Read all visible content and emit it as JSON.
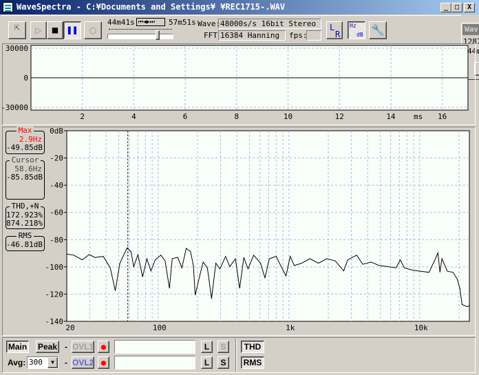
{
  "window": {
    "title": "WaveSpectra - C:¥Documents and Settings¥                    ¥REC1715-.WAV",
    "minimize": "_",
    "maximize": "□",
    "close": "X"
  },
  "toolbar": {
    "elapsed": "44m41s",
    "transport": "⏮◀▶⏭",
    "total": "57m51s",
    "wave_label": "Wave:",
    "wave_value": "48000s/s 16bit Stereo",
    "fft_label": "FFT:",
    "fft_value": "16384 Hanning",
    "fps_label": "fps:",
    "fps_value": "",
    "position_fraction": 0.77,
    "lr_l": "L",
    "lr_r": "R",
    "hz": "Hz",
    "db": "dB"
  },
  "side_window": {
    "title": "Wav",
    "line1": "1287",
    "line2": "44m"
  },
  "waveform": {
    "y_ticks": [
      "30000",
      "0",
      "-30000"
    ],
    "x_ticks": [
      "2",
      "4",
      "6",
      "8",
      "10",
      "12",
      "14",
      "16"
    ],
    "x_unit": "ms",
    "xlim": [
      0,
      17
    ],
    "ylim": [
      -32768,
      32768
    ]
  },
  "readouts": {
    "max": {
      "label": "Max",
      "freq": "2.9Hz",
      "level": "-49.85dB"
    },
    "cursor": {
      "label": "Cursor",
      "freq": "58.6Hz",
      "level": "-85.85dB"
    },
    "thd": {
      "label": "THD,+N",
      "v1": "172.923%",
      "v2": "874.218%"
    },
    "rms": {
      "label": "RMS",
      "level": "-46.81dB"
    }
  },
  "chart_data": {
    "type": "line",
    "xscale": "log",
    "xlim": [
      20,
      24000
    ],
    "ylim": [
      -140,
      0
    ],
    "grid": true,
    "y_ticks": [
      "0dB",
      "-20",
      "-40",
      "-60",
      "-80",
      "-100",
      "-120",
      "-140"
    ],
    "x_ticks": [
      "20",
      "100",
      "1k",
      "10k"
    ],
    "cursor_hz": 58.6,
    "points": [
      [
        20,
        -90.6
      ],
      [
        22.6,
        -91.4
      ],
      [
        26.3,
        -94.8
      ],
      [
        29.7,
        -90.9
      ],
      [
        32.8,
        -93.1
      ],
      [
        38,
        -92.3
      ],
      [
        43,
        -100.7
      ],
      [
        47,
        -117.5
      ],
      [
        51,
        -97.3
      ],
      [
        58,
        -85.9
      ],
      [
        62,
        -88.9
      ],
      [
        65,
        -99.8
      ],
      [
        70,
        -91
      ],
      [
        76,
        -107.4
      ],
      [
        82,
        -94
      ],
      [
        88,
        -103
      ],
      [
        95,
        -94.8
      ],
      [
        105,
        -91.4
      ],
      [
        113,
        -95.6
      ],
      [
        122,
        -115.8
      ],
      [
        128,
        -94
      ],
      [
        141,
        -93
      ],
      [
        152,
        -100.7
      ],
      [
        164,
        -86.4
      ],
      [
        177,
        -88.9
      ],
      [
        186,
        -99
      ],
      [
        192,
        -120.8
      ],
      [
        205,
        -109
      ],
      [
        221,
        -96.5
      ],
      [
        238,
        -100.7
      ],
      [
        256,
        -123.4
      ],
      [
        276,
        -97.3
      ],
      [
        297,
        -101.5
      ],
      [
        328,
        -92.3
      ],
      [
        353,
        -99.8
      ],
      [
        390,
        -94
      ],
      [
        420,
        -115.8
      ],
      [
        452,
        -93
      ],
      [
        487,
        -101.5
      ],
      [
        538,
        -91.4
      ],
      [
        607,
        -97.3
      ],
      [
        656,
        -108.2
      ],
      [
        707,
        -94
      ],
      [
        799,
        -92.3
      ],
      [
        882,
        -100.7
      ],
      [
        951,
        -106.6
      ],
      [
        1023,
        -92.3
      ],
      [
        1100,
        -99
      ],
      [
        1253,
        -97.3
      ],
      [
        1448,
        -94
      ],
      [
        1681,
        -97.3
      ],
      [
        1950,
        -94
      ],
      [
        2264,
        -95.6
      ],
      [
        2626,
        -103
      ],
      [
        2820,
        -94.8
      ],
      [
        3300,
        -91.4
      ],
      [
        3670,
        -98.1
      ],
      [
        4250,
        -96.5
      ],
      [
        4920,
        -99
      ],
      [
        5700,
        -99.8
      ],
      [
        6610,
        -100.7
      ],
      [
        7100,
        -94.8
      ],
      [
        7630,
        -100.7
      ],
      [
        8810,
        -102.4
      ],
      [
        10200,
        -103.2
      ],
      [
        11800,
        -104
      ],
      [
        13100,
        -94.8
      ],
      [
        13800,
        -89.7
      ],
      [
        14300,
        -104
      ],
      [
        14800,
        -94
      ],
      [
        16300,
        -103.2
      ],
      [
        18000,
        -104
      ],
      [
        19400,
        -109
      ],
      [
        20300,
        -115.8
      ],
      [
        21100,
        -127.6
      ],
      [
        23100,
        -129.3
      ],
      [
        24000,
        -128.4
      ]
    ]
  },
  "bottom": {
    "main": "Main",
    "peak": "Peak",
    "dash": "-",
    "ovl1": "OVL1",
    "ovl2": "OVL2",
    "avg_label": "Avg:",
    "avg_value": "300",
    "l": "L",
    "s": "S",
    "thd": "THD",
    "rms": "RMS",
    "field1": "",
    "field2": ""
  },
  "colors": {
    "max_text": "#ff0000",
    "ovl2_text": "#6060e0",
    "grid": "#b0b0f0",
    "record": "#ff0000"
  }
}
